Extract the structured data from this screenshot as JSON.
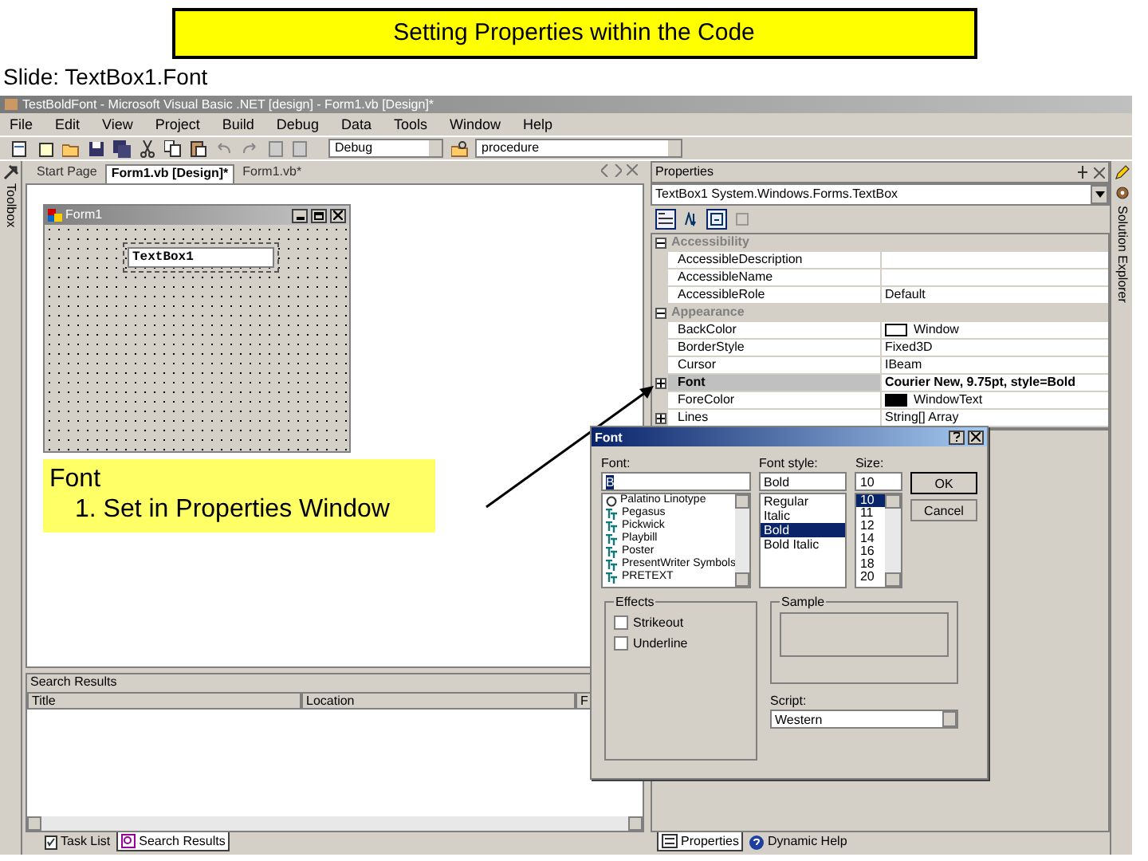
{
  "slide": {
    "banner": "Setting Properties within the Code",
    "subtitle": "Slide: TextBox1.Font"
  },
  "ide": {
    "title": "TestBoldFont - Microsoft Visual Basic .NET [design] - Form1.vb [Design]*",
    "menu": [
      "File",
      "Edit",
      "View",
      "Project",
      "Build",
      "Debug",
      "Data",
      "Tools",
      "Window",
      "Help"
    ],
    "toolbar": {
      "configuration": "Debug",
      "find": "procedure"
    },
    "left_strip": "Toolbox",
    "right_strip": "Solution Explorer",
    "doc_tabs": [
      {
        "label": "Start Page",
        "selected": false
      },
      {
        "label": "Form1.vb [Design]*",
        "selected": true
      },
      {
        "label": "Form1.vb*",
        "selected": false
      }
    ],
    "form": {
      "title": "Form1",
      "textbox": "TextBox1"
    },
    "callout": {
      "heading": "Font",
      "step": "1. Set in Properties Window"
    },
    "search_results": {
      "title": "Search Results",
      "columns": [
        "Title",
        "Location",
        "F"
      ]
    },
    "bottom_tabs_left": [
      {
        "label": "Task List",
        "selected": false
      },
      {
        "label": "Search Results",
        "selected": true
      }
    ],
    "properties": {
      "title": "Properties",
      "object": "TextBox1 System.Windows.Forms.TextBox",
      "rows": [
        {
          "kind": "category",
          "name": "Accessibility",
          "expanded": true
        },
        {
          "kind": "property",
          "name": "AccessibleDescription",
          "selected": false
        },
        {
          "kind": "property",
          "name": "AccessibleName",
          "selected": false
        },
        {
          "kind": "property",
          "name": "AccessibleRole",
          "value": "Default",
          "selected": false
        },
        {
          "kind": "category",
          "name": "Appearance",
          "expanded": true
        },
        {
          "kind": "property",
          "name": "BackColor",
          "value": "Window",
          "color": "#ffffff",
          "selected": false
        },
        {
          "kind": "property",
          "name": "BorderStyle",
          "value": "Fixed3D",
          "selected": false
        },
        {
          "kind": "property",
          "name": "Cursor",
          "value": "IBeam",
          "selected": false
        },
        {
          "kind": "group",
          "name": "Font",
          "value": "Courier New, 9.75pt, style=Bold",
          "expanded": false,
          "selected": true
        },
        {
          "kind": "property",
          "name": "ForeColor",
          "value": "WindowText",
          "color": "#000000",
          "selected": false
        },
        {
          "kind": "group",
          "name": "Lines",
          "value": "String[] Array",
          "expanded": false,
          "selected": false
        }
      ]
    },
    "bottom_tabs_right": [
      {
        "label": "Properties",
        "selected": true
      },
      {
        "label": "Dynamic Help",
        "selected": false
      }
    ]
  },
  "font_dialog": {
    "title": "Font",
    "font": {
      "label": "Font:",
      "value": "B",
      "items": [
        "Palatino Linotype",
        "Pegasus",
        "Pickwick",
        "Playbill",
        "Poster",
        "PresentWriter Symbols",
        "PRETEXT"
      ]
    },
    "style": {
      "label": "Font style:",
      "value": "Bold",
      "items": [
        {
          "label": "Regular",
          "selected": false
        },
        {
          "label": "Italic",
          "selected": false
        },
        {
          "label": "Bold",
          "selected": true
        },
        {
          "label": "Bold Italic",
          "selected": false
        }
      ]
    },
    "size": {
      "label": "Size:",
      "value": "10",
      "items": [
        {
          "label": "10",
          "selected": true
        },
        {
          "label": "11",
          "selected": false
        },
        {
          "label": "12",
          "selected": false
        },
        {
          "label": "14",
          "selected": false
        },
        {
          "label": "16",
          "selected": false
        },
        {
          "label": "18",
          "selected": false
        },
        {
          "label": "20",
          "selected": false
        }
      ]
    },
    "buttons": [
      "OK",
      "Cancel"
    ],
    "effects": {
      "title": "Effects",
      "options": [
        {
          "label": "Strikeout",
          "checked": false
        },
        {
          "label": "Underline",
          "checked": false
        }
      ]
    },
    "sample": {
      "title": "Sample"
    },
    "script": {
      "label": "Script:",
      "value": "Western"
    }
  }
}
